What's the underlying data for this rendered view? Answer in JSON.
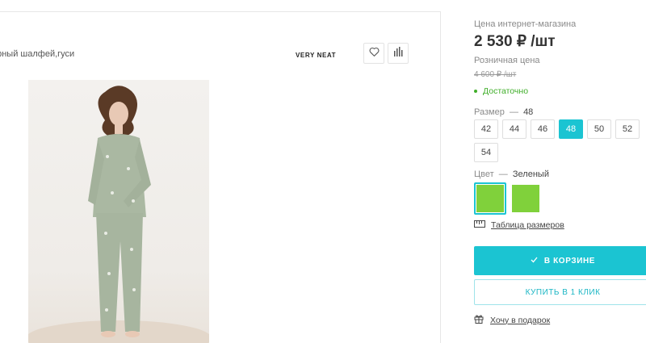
{
  "product": {
    "name": "орный шалфей,гуси",
    "brand": "VERY NEAT"
  },
  "icons": {
    "favorite": "heart-icon",
    "compare": "bar-chart-icon",
    "size_table": "ruler-icon",
    "gift": "gift-icon",
    "cart_check": "check-icon"
  },
  "pricing": {
    "online_label": "Цена интернет-магазина",
    "online_price": "2 530 ₽ /шт",
    "retail_label": "Розничная цена",
    "retail_price": "4 600 ₽ /шт",
    "stock_text": "Достаточно"
  },
  "size": {
    "label": "Размер",
    "separator": "—",
    "selected": "48",
    "options": [
      "42",
      "44",
      "46",
      "48",
      "50",
      "52",
      "54"
    ]
  },
  "color": {
    "label": "Цвет",
    "separator": "—",
    "selected": "Зеленый",
    "swatch_hex": "#80d13b"
  },
  "links": {
    "size_table": "Таблица размеров",
    "gift": "Хочу в подарок"
  },
  "buttons": {
    "cart": "В КОРЗИНЕ",
    "one_click": "КУПИТЬ В 1 КЛИК"
  },
  "colors": {
    "accent": "#1bc4d2",
    "stock_green": "#3fae29"
  }
}
